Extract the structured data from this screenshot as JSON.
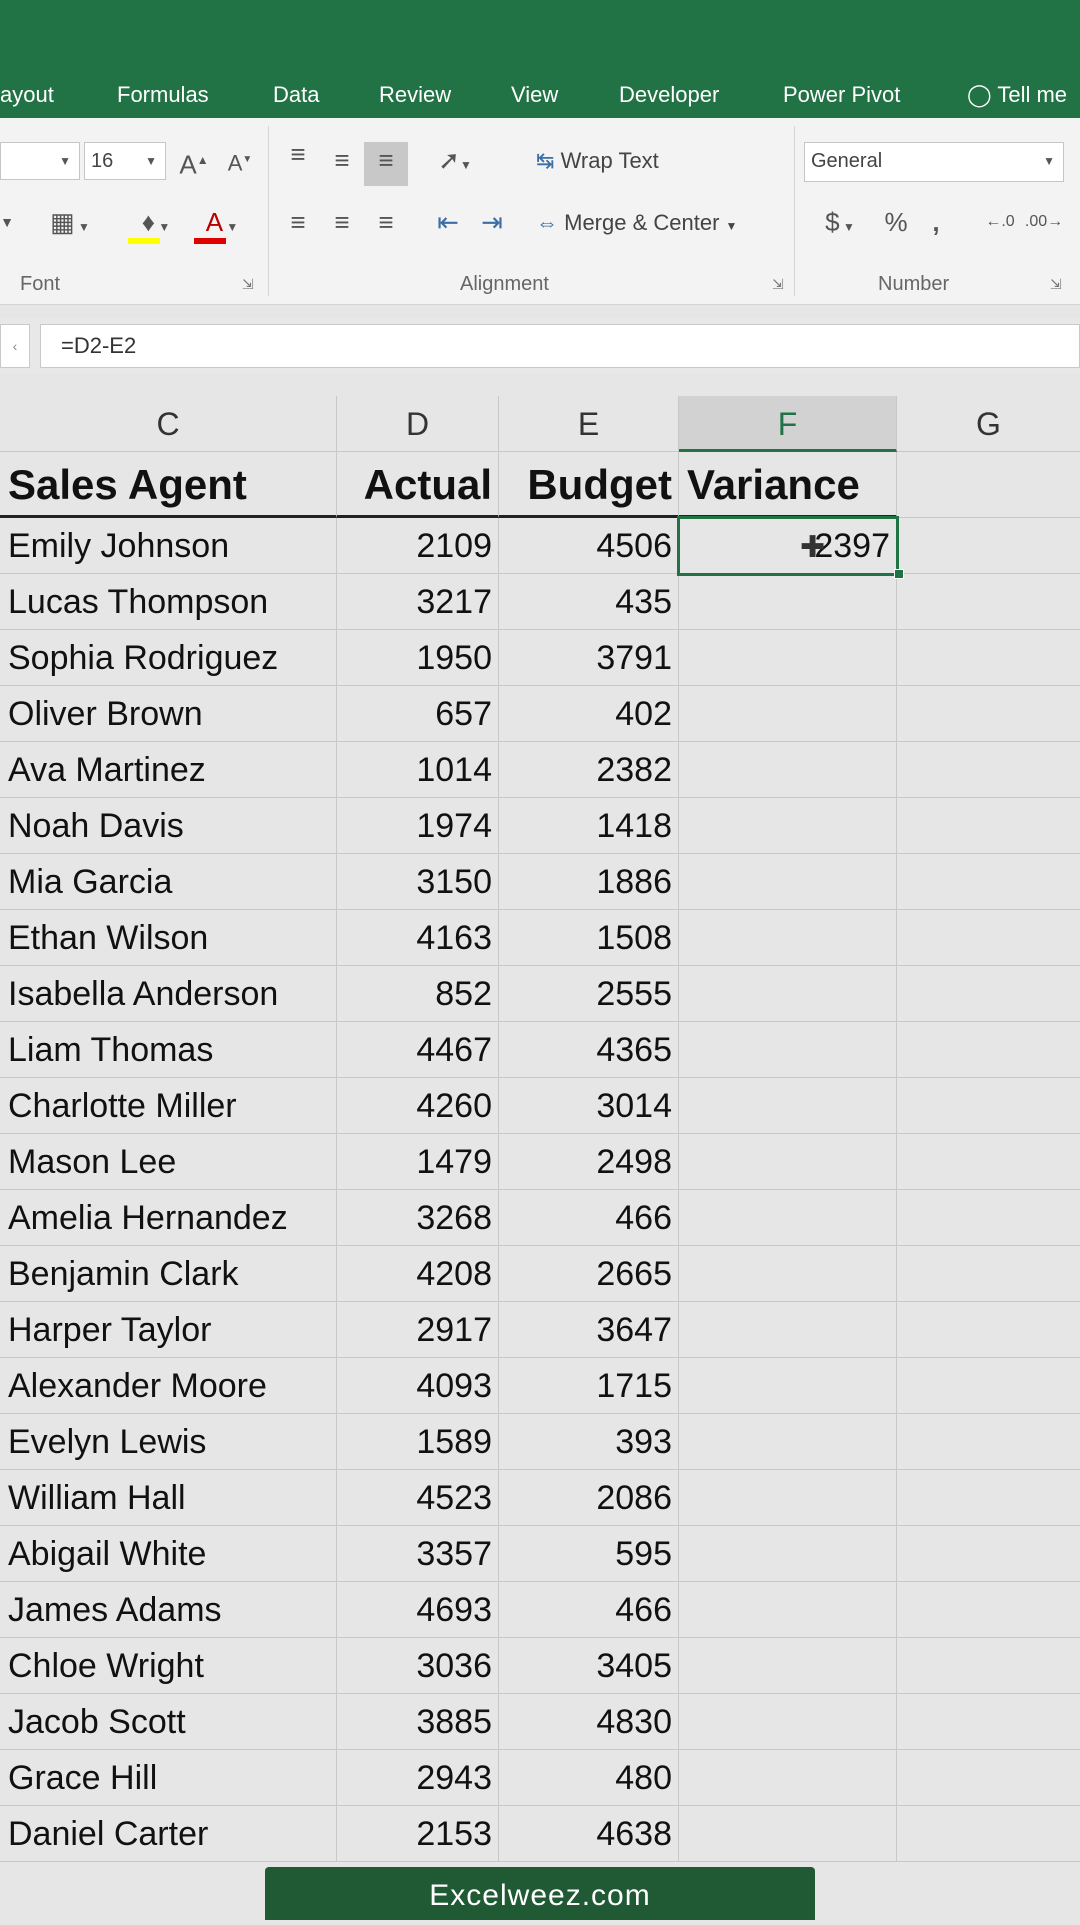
{
  "ribbon_tabs": [
    "ayout",
    "Formulas",
    "Data",
    "Review",
    "View",
    "Developer",
    "Power Pivot",
    "Tell me"
  ],
  "font": {
    "size": "16",
    "group_label": "Font"
  },
  "alignment": {
    "wrap_text": "Wrap Text",
    "merge_center": "Merge & Center",
    "group_label": "Alignment"
  },
  "number": {
    "format": "General",
    "group_label": "Number",
    "currency": "$",
    "percent": "%",
    "comma": ","
  },
  "formula_bar": {
    "formula": "=D2-E2"
  },
  "columns": [
    "C",
    "D",
    "E",
    "F",
    "G"
  ],
  "headers": {
    "agent": "Sales Agent",
    "actual": "Actual",
    "budget": "Budget",
    "variance": "Variance"
  },
  "rows": [
    {
      "agent": "Emily Johnson",
      "actual": "2109",
      "budget": "4506",
      "variance": "-2397"
    },
    {
      "agent": "Lucas Thompson",
      "actual": "3217",
      "budget": "435",
      "variance": ""
    },
    {
      "agent": "Sophia Rodriguez",
      "actual": "1950",
      "budget": "3791",
      "variance": ""
    },
    {
      "agent": "Oliver Brown",
      "actual": "657",
      "budget": "402",
      "variance": ""
    },
    {
      "agent": "Ava Martinez",
      "actual": "1014",
      "budget": "2382",
      "variance": ""
    },
    {
      "agent": "Noah Davis",
      "actual": "1974",
      "budget": "1418",
      "variance": ""
    },
    {
      "agent": "Mia Garcia",
      "actual": "3150",
      "budget": "1886",
      "variance": ""
    },
    {
      "agent": "Ethan Wilson",
      "actual": "4163",
      "budget": "1508",
      "variance": ""
    },
    {
      "agent": "Isabella Anderson",
      "actual": "852",
      "budget": "2555",
      "variance": ""
    },
    {
      "agent": "Liam Thomas",
      "actual": "4467",
      "budget": "4365",
      "variance": ""
    },
    {
      "agent": "Charlotte Miller",
      "actual": "4260",
      "budget": "3014",
      "variance": ""
    },
    {
      "agent": "Mason Lee",
      "actual": "1479",
      "budget": "2498",
      "variance": ""
    },
    {
      "agent": "Amelia Hernandez",
      "actual": "3268",
      "budget": "466",
      "variance": ""
    },
    {
      "agent": "Benjamin Clark",
      "actual": "4208",
      "budget": "2665",
      "variance": ""
    },
    {
      "agent": "Harper Taylor",
      "actual": "2917",
      "budget": "3647",
      "variance": ""
    },
    {
      "agent": "Alexander Moore",
      "actual": "4093",
      "budget": "1715",
      "variance": ""
    },
    {
      "agent": "Evelyn Lewis",
      "actual": "1589",
      "budget": "393",
      "variance": ""
    },
    {
      "agent": "William Hall",
      "actual": "4523",
      "budget": "2086",
      "variance": ""
    },
    {
      "agent": "Abigail White",
      "actual": "3357",
      "budget": "595",
      "variance": ""
    },
    {
      "agent": "James Adams",
      "actual": "4693",
      "budget": "466",
      "variance": ""
    },
    {
      "agent": "Chloe Wright",
      "actual": "3036",
      "budget": "3405",
      "variance": ""
    },
    {
      "agent": "Jacob Scott",
      "actual": "3885",
      "budget": "4830",
      "variance": ""
    },
    {
      "agent": "Grace Hill",
      "actual": "2943",
      "budget": "480",
      "variance": ""
    },
    {
      "agent": "Daniel Carter",
      "actual": "2153",
      "budget": "4638",
      "variance": ""
    }
  ],
  "watermark": "Excelweez.com",
  "colors": {
    "excel_green": "#217346",
    "font_color_bar": "#e00000",
    "fill_color_bar": "#ffff00"
  }
}
